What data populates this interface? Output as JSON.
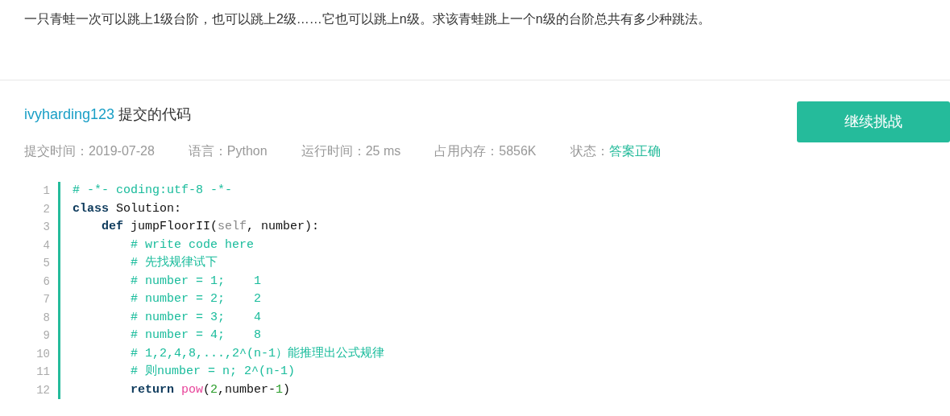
{
  "question": "一只青蛙一次可以跳上1级台阶，也可以跳上2级……它也可以跳上n级。求该青蛙跳上一个n级的台阶总共有多少种跳法。",
  "submission": {
    "user": "ivyharding123",
    "title_suffix": "提交的代码",
    "continue_button": "继续挑战",
    "meta": [
      {
        "label": "提交时间：",
        "value": "2019-07-28",
        "kind": "plain"
      },
      {
        "label": "语言：",
        "value": "Python",
        "kind": "plain"
      },
      {
        "label": "运行时间：",
        "value": "25 ms",
        "kind": "plain"
      },
      {
        "label": "占用内存：",
        "value": "5856K",
        "kind": "plain"
      },
      {
        "label": "状态：",
        "value": "答案正确",
        "kind": "status"
      }
    ]
  },
  "code": [
    {
      "line_number": "1",
      "tokens": [
        {
          "kind": "comment",
          "text": "# -*- coding:utf-8 -*-"
        }
      ]
    },
    {
      "line_number": "2",
      "tokens": [
        {
          "kind": "keyword",
          "text": "class"
        },
        {
          "kind": "plain",
          "text": " Solution:"
        }
      ],
      "children": [
        {
          "line_number": "3",
          "tokens": [
            {
              "kind": "keyword",
              "text": "def"
            },
            {
              "kind": "plain",
              "text": " jumpFloorII("
            },
            {
              "kind": "self",
              "text": "self"
            },
            {
              "kind": "plain",
              "text": ", number):"
            }
          ],
          "children": [
            {
              "line_number": "4",
              "tokens": [
                {
                  "kind": "comment",
                  "text": "# write code here"
                }
              ]
            },
            {
              "line_number": "5",
              "tokens": [
                {
                  "kind": "comment",
                  "text": "# 先找规律试下"
                }
              ]
            },
            {
              "line_number": "6",
              "tokens": [
                {
                  "kind": "comment",
                  "text": "# number = 1;    1"
                }
              ]
            },
            {
              "line_number": "7",
              "tokens": [
                {
                  "kind": "comment",
                  "text": "# number = 2;    2"
                }
              ]
            },
            {
              "line_number": "8",
              "tokens": [
                {
                  "kind": "comment",
                  "text": "# number = 3;    4"
                }
              ]
            },
            {
              "line_number": "9",
              "tokens": [
                {
                  "kind": "comment",
                  "text": "# number = 4;    8"
                }
              ]
            },
            {
              "line_number": "10",
              "tokens": [
                {
                  "kind": "comment",
                  "text": "# 1,2,4,8,...,2^(n-1）能推理出公式规律"
                }
              ]
            },
            {
              "line_number": "11",
              "tokens": [
                {
                  "kind": "comment",
                  "text": "# 则number = n; 2^(n-1)"
                }
              ]
            },
            {
              "line_number": "12",
              "tokens": [
                {
                  "kind": "keyword",
                  "text": "return"
                },
                {
                  "kind": "builtin",
                  "text": " pow"
                },
                {
                  "kind": "plain",
                  "text": "("
                },
                {
                  "kind": "number",
                  "text": "2"
                },
                {
                  "kind": "plain",
                  "text": ",number-"
                },
                {
                  "kind": "number",
                  "text": "1"
                },
                {
                  "kind": "plain",
                  "text": ")"
                }
              ]
            }
          ]
        }
      ]
    }
  ]
}
